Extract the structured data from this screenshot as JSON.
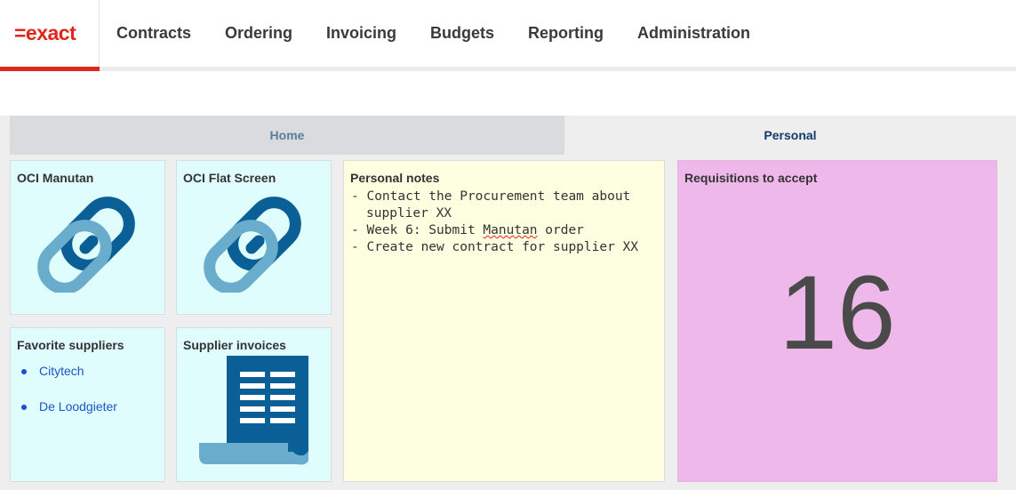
{
  "brand": {
    "logo_text": "=exact",
    "accent_color": "#e1261c"
  },
  "nav": {
    "items": [
      "Contracts",
      "Ordering",
      "Invoicing",
      "Budgets",
      "Reporting",
      "Administration"
    ]
  },
  "tabs": {
    "home": "Home",
    "personal": "Personal"
  },
  "tiles": {
    "oci_manutan": {
      "title": "OCI Manutan",
      "icon": "link-icon"
    },
    "oci_flat_screen": {
      "title": "OCI Flat Screen",
      "icon": "link-icon"
    },
    "favorite_suppliers": {
      "title": "Favorite suppliers",
      "items": [
        "Citytech",
        "De Loodgieter"
      ]
    },
    "supplier_invoices": {
      "title": "Supplier invoices",
      "icon": "invoice-document-icon"
    },
    "personal_notes": {
      "title": "Personal notes",
      "lines": [
        {
          "prefix": "- ",
          "text": "Contact the Procurement team about supplier XX"
        },
        {
          "prefix": "- ",
          "before": "Week 6: Submit ",
          "flagged": "Manutan",
          "after": " order"
        },
        {
          "prefix": "- ",
          "text": "Create new contract for supplier XX"
        }
      ]
    },
    "requisitions": {
      "title": "Requisitions to accept",
      "count": "16"
    }
  },
  "colors": {
    "tile_cyan": "#e0fdfd",
    "tile_yellow": "#fefee0",
    "tile_pink": "#efb8ea",
    "icon_dark_blue": "#0a5f96",
    "icon_light_blue": "#6aaccc"
  }
}
